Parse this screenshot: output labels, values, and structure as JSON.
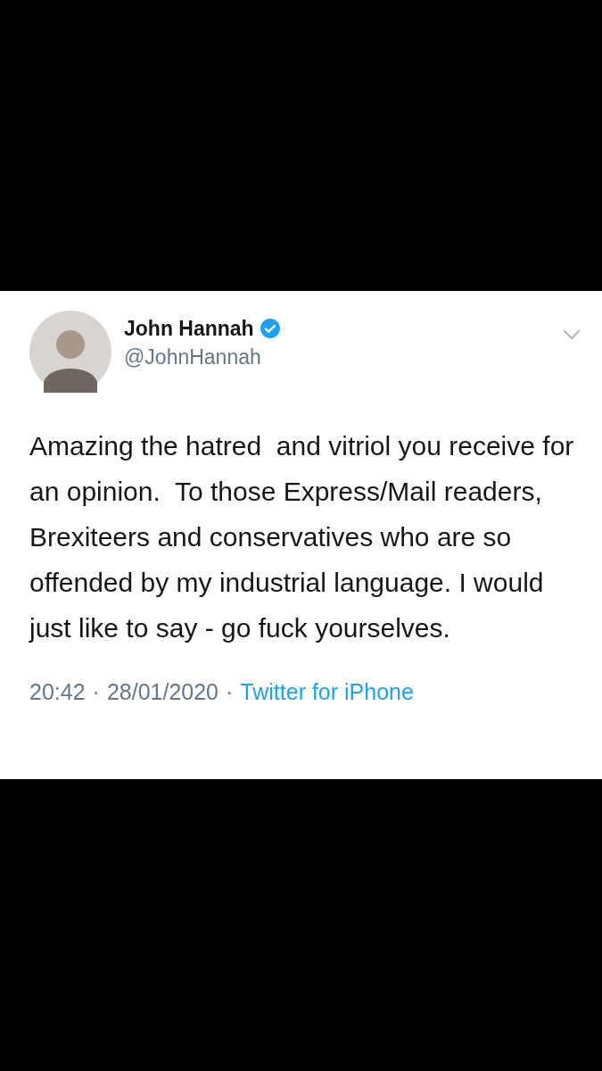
{
  "tweet": {
    "author": {
      "name": "John Hannah",
      "handle": "@JohnHannah",
      "verified": true
    },
    "text": "Amazing the hatred  and vitriol you receive for an opinion.  To those Express/Mail readers, Brexiteers and conservatives who are so offended by my industrial language. I would just like to say - go fuck yourselves.",
    "time": "20:42",
    "separator": "·",
    "date": "28/01/2020",
    "source_separator": "·",
    "source": "Twitter for iPhone"
  }
}
